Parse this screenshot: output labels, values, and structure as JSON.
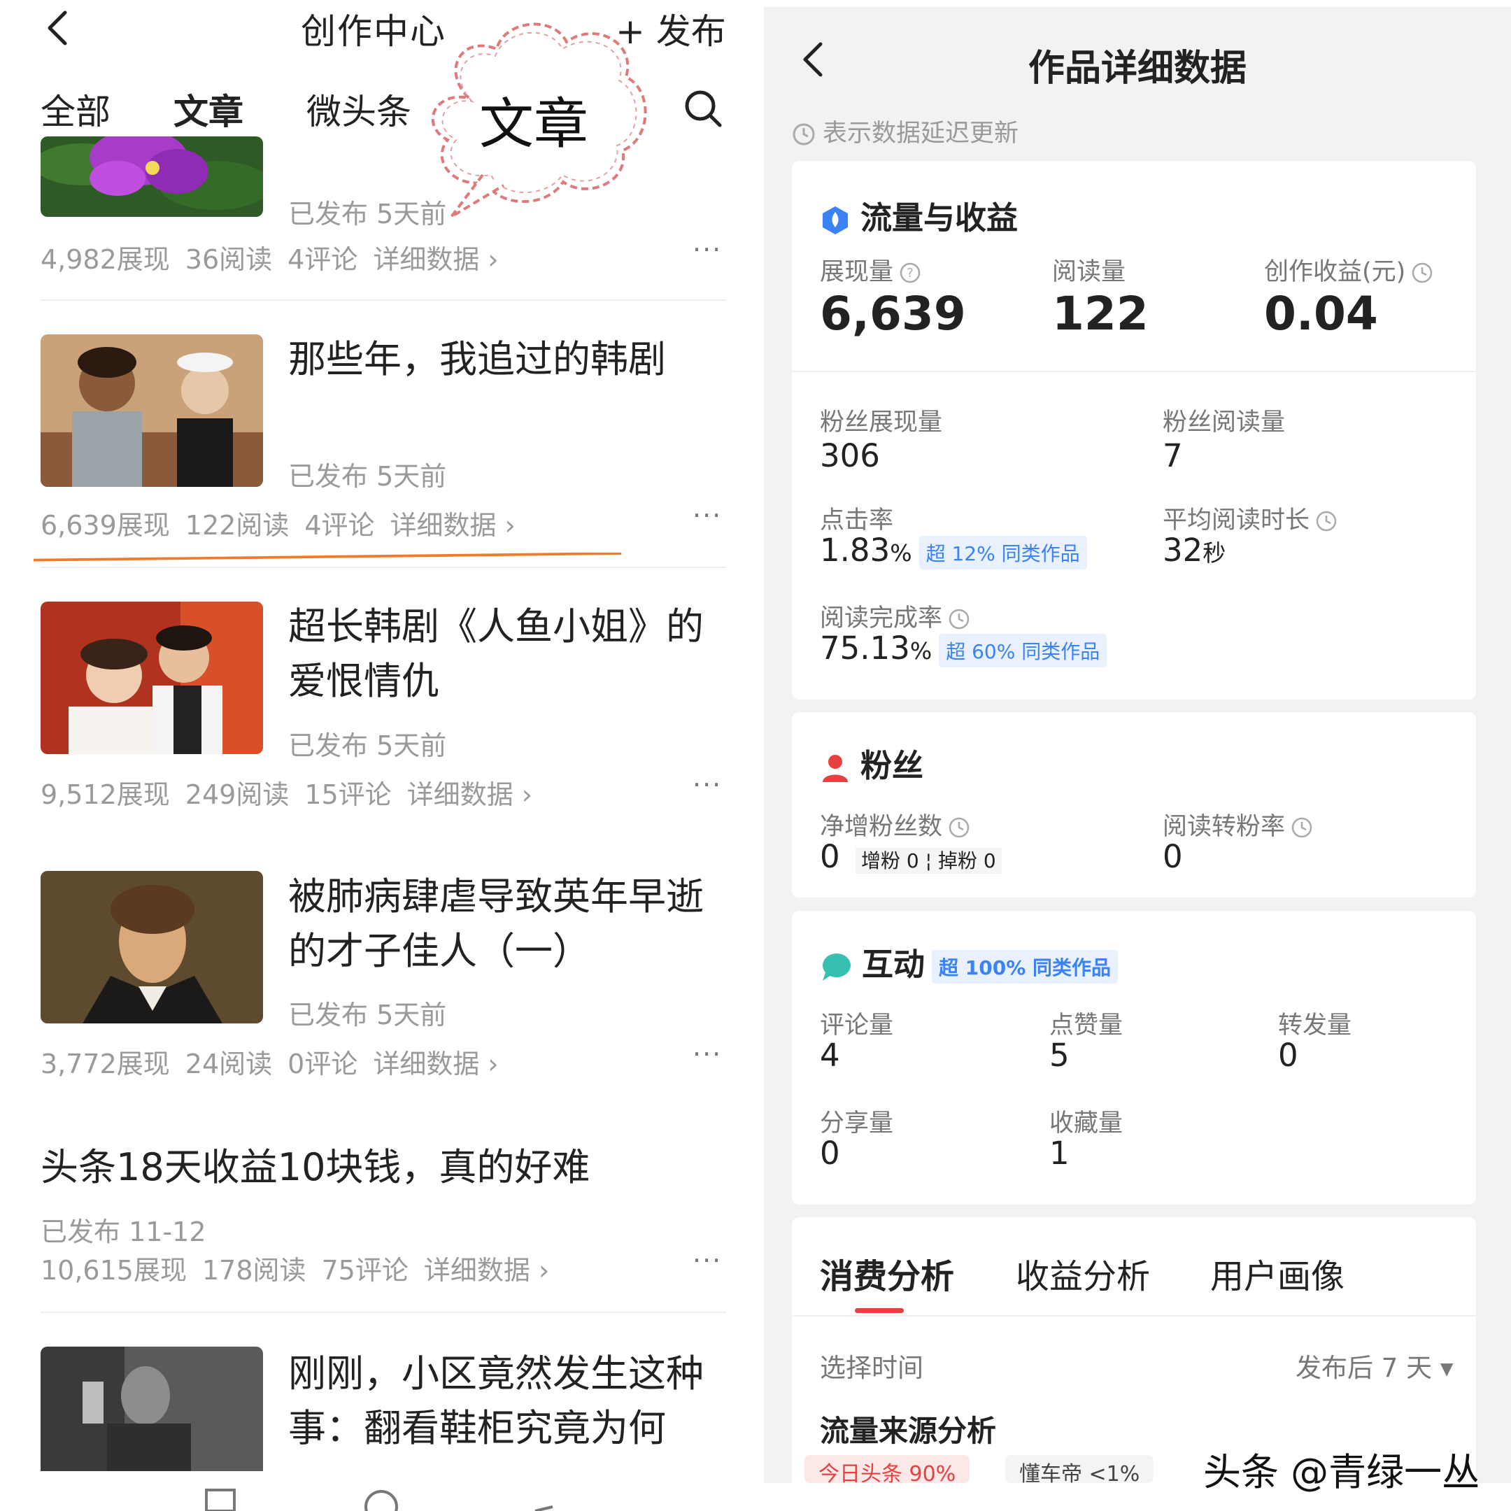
{
  "left": {
    "title": "创作中心",
    "publish": "+ 发布",
    "tabs": [
      "全部",
      "文章",
      "微头条"
    ],
    "annotation": "文章",
    "articles": [
      {
        "title": "",
        "published": "已发布  5天前",
        "stats": [
          "4,982展现",
          "36阅读",
          "4评论",
          "详细数据 ›"
        ]
      },
      {
        "title": "那些年，我追过的韩剧",
        "published": "已发布  5天前",
        "stats": [
          "6,639展现",
          "122阅读",
          "4评论",
          "详细数据 ›"
        ]
      },
      {
        "title": "超长韩剧《人鱼小姐》的爱恨情仇",
        "published": "已发布  5天前",
        "stats": [
          "9,512展现",
          "249阅读",
          "15评论",
          "详细数据 ›"
        ]
      },
      {
        "title": "被肺病肆虐导致英年早逝的才子佳人（一）",
        "published": "已发布  5天前",
        "stats": [
          "3,772展现",
          "24阅读",
          "0评论",
          "详细数据 ›"
        ]
      },
      {
        "title": "头条18天收益10块钱，真的好难",
        "published": "已发布  11-12",
        "stats": [
          "10,615展现",
          "178阅读",
          "75评论",
          "详细数据 ›"
        ]
      },
      {
        "title": "刚刚，小区竟然发生这种事：翻看鞋柜究竟为何",
        "published": "",
        "stats": []
      }
    ],
    "more": "···"
  },
  "right": {
    "title": "作品详细数据",
    "note": "表示数据延迟更新",
    "traffic": {
      "heading": "流量与收益",
      "impressions_label": "展现量",
      "impressions": "6,639",
      "reads_label": "阅读量",
      "reads": "122",
      "income_label": "创作收益(元)",
      "income": "0.04",
      "fan_impr_label": "粉丝展现量",
      "fan_impr": "306",
      "fan_reads_label": "粉丝阅读量",
      "fan_reads": "7",
      "ctr_label": "点击率",
      "ctr": "1.83",
      "ctr_badge": "超 12% 同类作品",
      "avg_time_label": "平均阅读时长",
      "avg_time": "32",
      "avg_time_unit": "秒",
      "completion_label": "阅读完成率",
      "completion": "75.13",
      "completion_badge": "超 60% 同类作品",
      "percent_unit": "%"
    },
    "fans": {
      "heading": "粉丝",
      "net_label": "净增粉丝数",
      "net": "0",
      "gain_label": "增粉",
      "gain": "0",
      "loss_label": "掉粉",
      "loss": "0",
      "conv_label": "阅读转粉率",
      "conv": "0"
    },
    "interact": {
      "heading": "互动",
      "badge": "超 100% 同类作品",
      "comments_label": "评论量",
      "comments": "4",
      "likes_label": "点赞量",
      "likes": "5",
      "forwards_label": "转发量",
      "forwards": "0",
      "shares_label": "分享量",
      "shares": "0",
      "favs_label": "收藏量",
      "favs": "1"
    },
    "analysis": {
      "tabs": [
        "消费分析",
        "收益分析",
        "用户画像"
      ],
      "time_label": "选择时间",
      "time_value": "发布后 7 天 ▾",
      "source_label": "流量来源分析",
      "chips": [
        "今日头条 90%",
        "懂车帝 <1%"
      ]
    }
  },
  "watermark": "头条 @青绿一丛",
  "colors": {
    "accent_red": "#e64040",
    "orange_mark": "#f07a2a",
    "badge_blue": "#3b82f6",
    "stat_gray": "#9a9a9a"
  }
}
